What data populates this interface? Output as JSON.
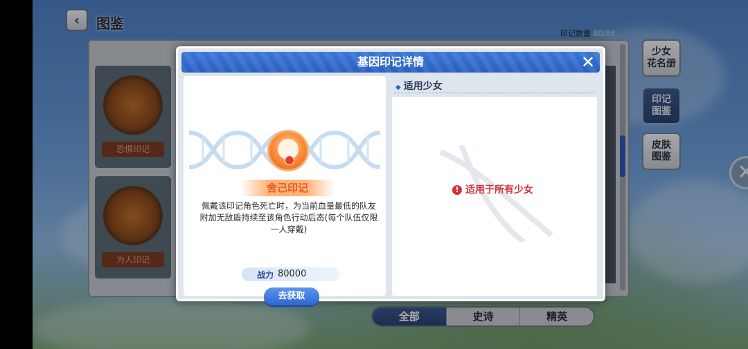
{
  "page_title": "图鉴",
  "counter": {
    "label": "印记数量",
    "value": "80/88"
  },
  "cards": [
    {
      "name": "恐惧印记"
    },
    {
      "name": "为人印记"
    }
  ],
  "side_buttons": [
    {
      "label": "少女\n花名册",
      "active": false
    },
    {
      "label": "印记\n图鉴",
      "active": true
    },
    {
      "label": "皮肤\n图鉴",
      "active": false
    }
  ],
  "filter_tabs": [
    {
      "label": "全部",
      "active": true
    },
    {
      "label": "史诗",
      "active": false
    },
    {
      "label": "精英",
      "active": false
    }
  ],
  "modal": {
    "title": "基因印记详情",
    "mark_name": "舍己印记",
    "description": "佩戴该印记角色死亡时，为当前血量最低的队友附加无敌盾持续至该角色行动后态(每个队伍仅限一人穿戴)",
    "power_label": "战力",
    "power_value": "80000",
    "get_button": "去获取",
    "right_header": "适用少女",
    "applies_text": "适用于所有少女"
  },
  "colors": {
    "header_blue": "#2b5fbf",
    "accent_orange": "#e85c18",
    "warn_red": "#d6333a"
  },
  "icons": [
    "back-arrow-icon",
    "close-icon",
    "dna-helix-icon",
    "medal-icon",
    "warning-icon"
  ]
}
